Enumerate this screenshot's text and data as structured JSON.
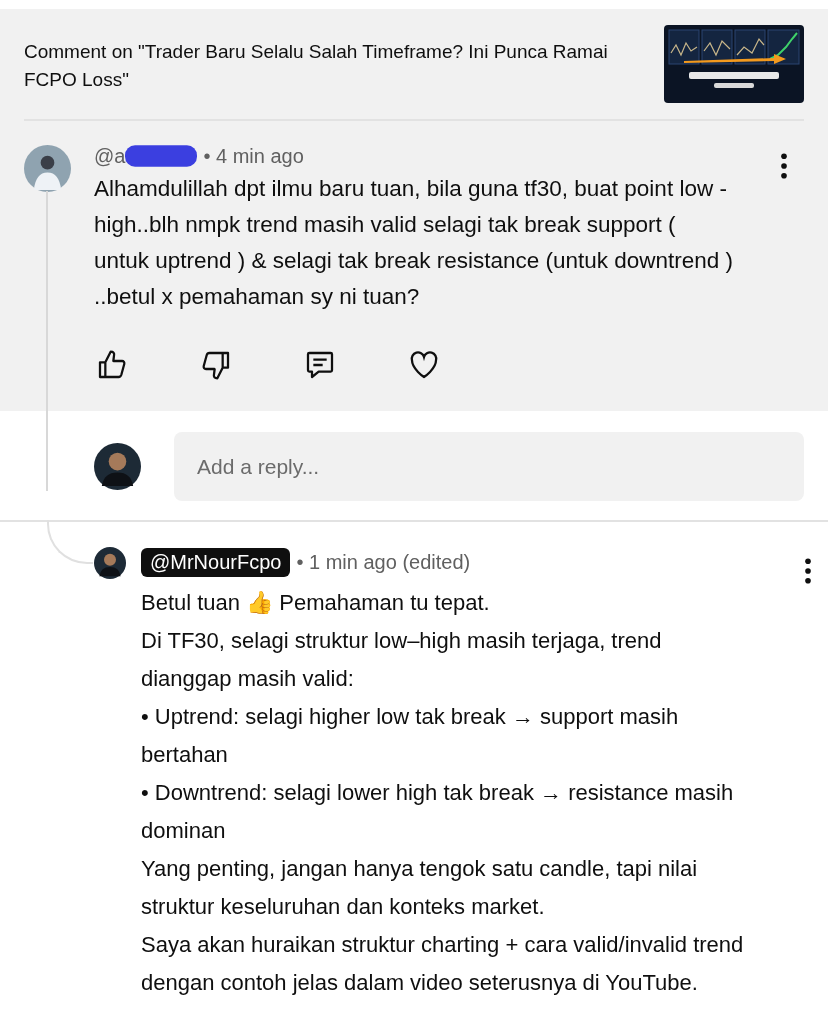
{
  "header": {
    "title": "Comment on \"Trader Baru Selalu Salah Timeframe? Ini Punca Ramai FCPO Loss\""
  },
  "comment": {
    "author": "@a",
    "redacted": true,
    "highlighted": false,
    "time": "• 4 min ago",
    "text": "Alhamdulillah dpt ilmu baru tuan, bila guna tf30, buat point low - high..blh nmpk trend masih valid selagi tak break support ( untuk uptrend ) & selagi tak break resistance (untuk downtrend ) ..betul x pemahaman sy ni tuan?",
    "liked": false,
    "disliked": false,
    "hearted": false
  },
  "reply_box": {
    "placeholder": "Add a reply..."
  },
  "reply": {
    "author": "@MrNourFcpo",
    "highlighted": true,
    "time": "• 1 min ago (edited)",
    "paragraphs": [
      "Betul tuan 👍 Pemahaman tu tepat.",
      "Di TF30, selagi struktur low–high masih terjaga, trend dianggap masih valid:",
      "• Uptrend: selagi higher low tak break → support masih bertahan",
      "• Downtrend: selagi lower high tak break → resistance masih dominan",
      "Yang penting, jangan hanya tengok satu candle, tapi nilai struktur keseluruhan dan konteks market.",
      "Saya akan huraikan struktur charting + cara valid/invalid trend dengan contoh jelas dalam video seterusnya di YouTube."
    ]
  }
}
